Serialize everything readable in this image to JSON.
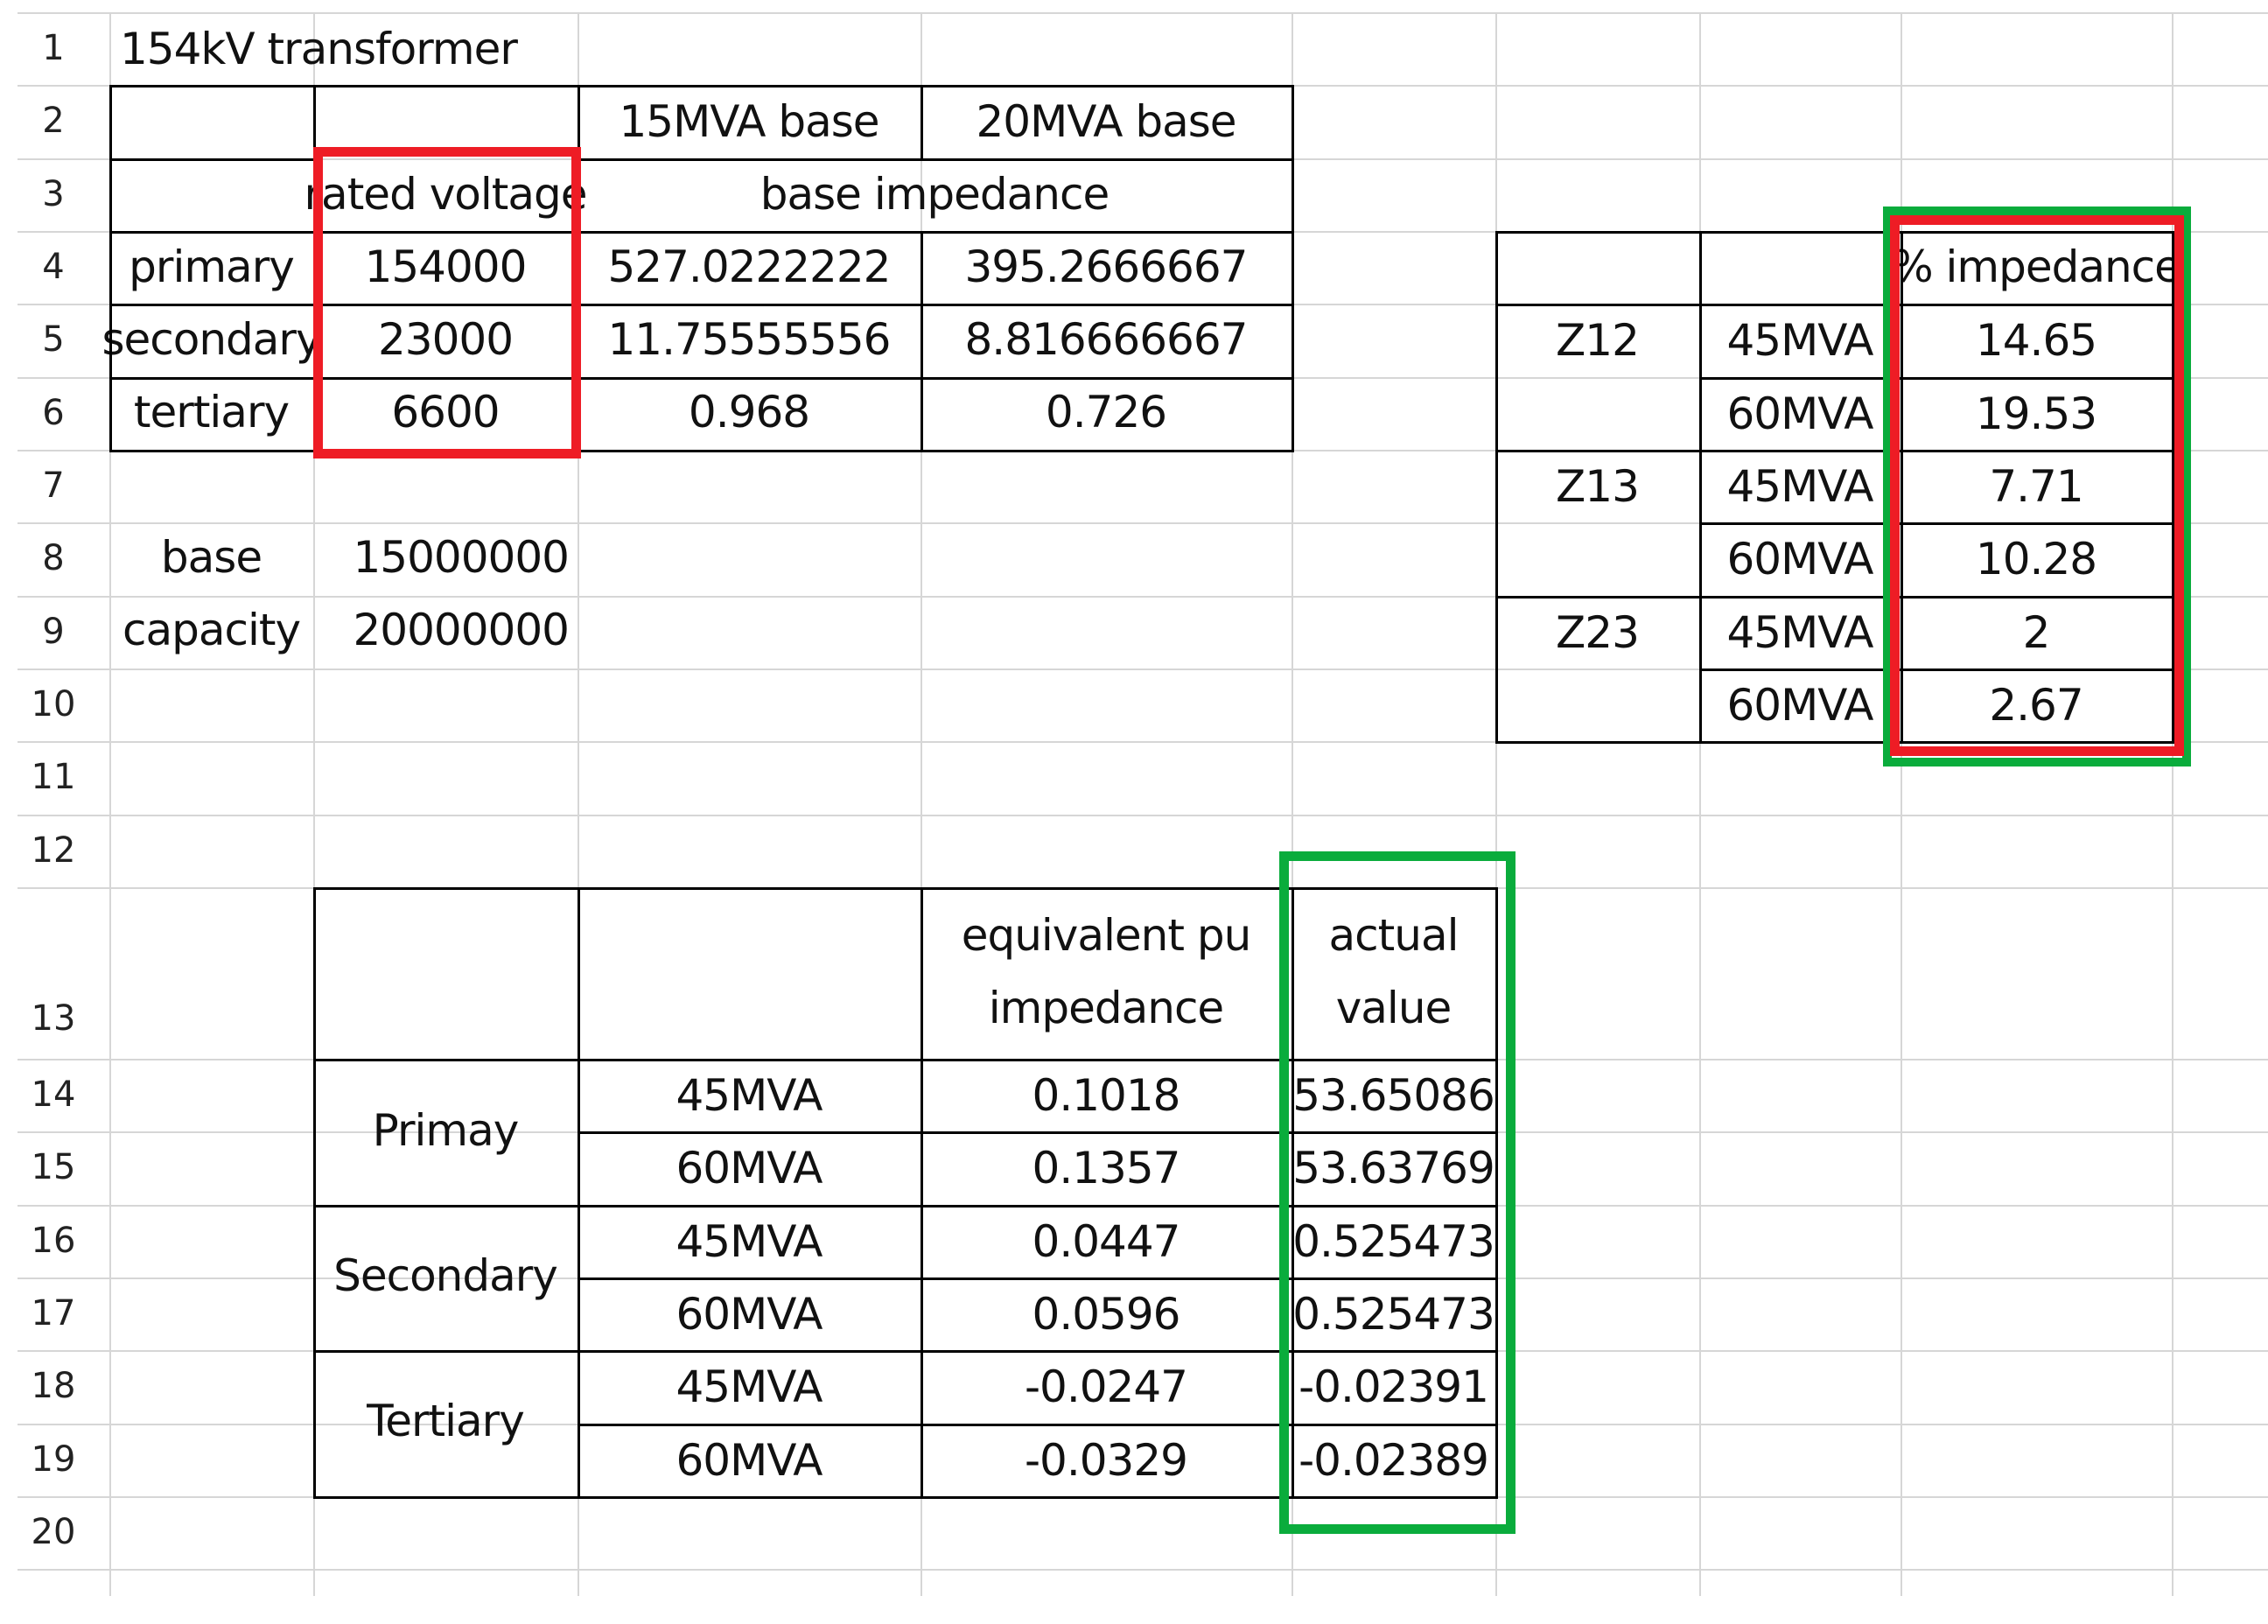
{
  "row_numbers": [
    "1",
    "2",
    "3",
    "4",
    "5",
    "6",
    "7",
    "8",
    "9",
    "10",
    "11",
    "12",
    "13",
    "14",
    "15",
    "16",
    "17",
    "18",
    "19",
    "20"
  ],
  "top_table": {
    "title": "154kV transformer",
    "header_15": "15MVA base",
    "header_20": "20MVA base",
    "rated_voltage_label": "rated voltage",
    "base_impedance_label": "base impedance",
    "rows": [
      {
        "label": "primary",
        "rated": "154000",
        "b15": "527.0222222",
        "b20": "395.2666667"
      },
      {
        "label": "secondary",
        "rated": "23000",
        "b15": "11.75555556",
        "b20": "8.816666667"
      },
      {
        "label": "tertiary",
        "rated": "6600",
        "b15": "0.968",
        "b20": "0.726"
      }
    ],
    "base_label": "base",
    "capacity_label": "capacity",
    "base_value": "15000000",
    "capacity_value": "20000000"
  },
  "impedance_table": {
    "header": "% impedance",
    "rows": [
      {
        "z": "Z12",
        "mva": "45MVA",
        "pct": "14.65"
      },
      {
        "z": "",
        "mva": "60MVA",
        "pct": "19.53"
      },
      {
        "z": "Z13",
        "mva": "45MVA",
        "pct": "7.71"
      },
      {
        "z": "",
        "mva": "60MVA",
        "pct": "10.28"
      },
      {
        "z": "Z23",
        "mva": "45MVA",
        "pct": "2"
      },
      {
        "z": "",
        "mva": "60MVA",
        "pct": "2.67"
      }
    ]
  },
  "bottom_table": {
    "header_pu_line1": "equivalent pu",
    "header_pu_line2": "impedance",
    "header_actual_line1": "actual",
    "header_actual_line2": "value",
    "groups": [
      "Primay",
      "Secondary",
      "Tertiary"
    ],
    "rows": [
      {
        "mva": "45MVA",
        "pu": "0.1018",
        "actual": "53.65086"
      },
      {
        "mva": "60MVA",
        "pu": "0.1357",
        "actual": "53.63769"
      },
      {
        "mva": "45MVA",
        "pu": "0.0447",
        "actual": "0.525473"
      },
      {
        "mva": "60MVA",
        "pu": "0.0596",
        "actual": "0.525473"
      },
      {
        "mva": "45MVA",
        "pu": "-0.0247",
        "actual": "-0.02391"
      },
      {
        "mva": "60MVA",
        "pu": "-0.0329",
        "actual": "-0.02389"
      }
    ]
  },
  "highlight_colors": {
    "red": "#ee1c25",
    "green": "#0aac3c"
  }
}
